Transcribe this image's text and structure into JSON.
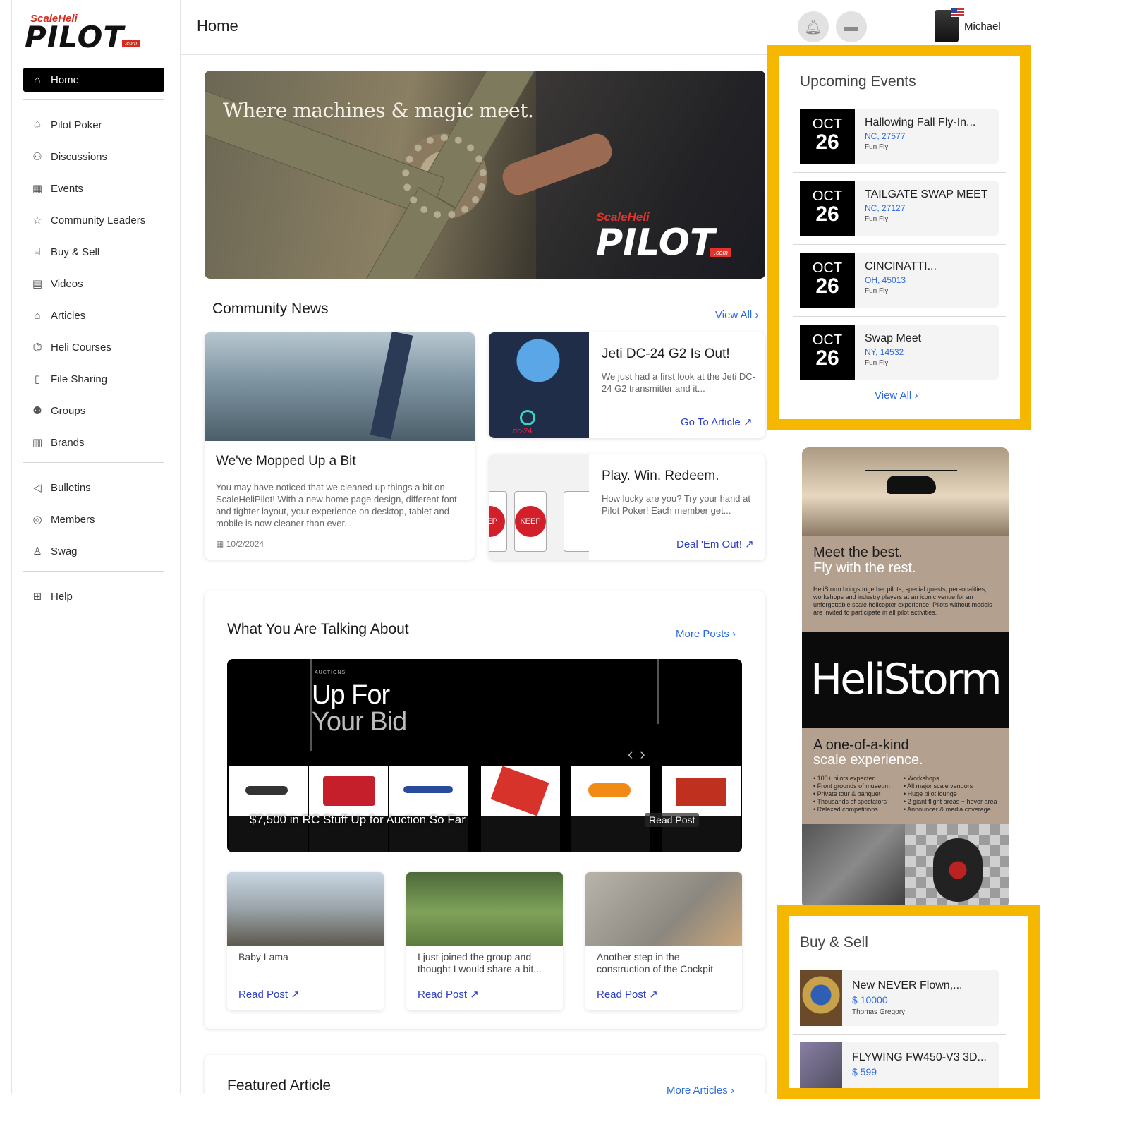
{
  "brand": {
    "logo_top": "ScaleHeli",
    "logo_main": "PILOT",
    "logo_suffix": ".com"
  },
  "header": {
    "title": "Home",
    "user_name": "Michael"
  },
  "sidebar": {
    "items": [
      {
        "label": "Home",
        "icon": "home-icon"
      },
      {
        "label": "Pilot Poker",
        "icon": "spade-icon"
      },
      {
        "label": "Discussions",
        "icon": "people-icon"
      },
      {
        "label": "Events",
        "icon": "calendar-icon"
      },
      {
        "label": "Community Leaders",
        "icon": "star-icon"
      },
      {
        "label": "Buy & Sell",
        "icon": "store-icon"
      },
      {
        "label": "Videos",
        "icon": "film-icon"
      },
      {
        "label": "Articles",
        "icon": "articles-icon"
      },
      {
        "label": "Heli Courses",
        "icon": "graduation-cap-icon"
      },
      {
        "label": "File Sharing",
        "icon": "file-icon"
      },
      {
        "label": "Groups",
        "icon": "group-icon"
      },
      {
        "label": "Brands",
        "icon": "building-icon"
      },
      {
        "label": "Bulletins",
        "icon": "megaphone-icon"
      },
      {
        "label": "Members",
        "icon": "user-circle-icon"
      },
      {
        "label": "Swag",
        "icon": "shirt-icon"
      },
      {
        "label": "Help",
        "icon": "help-icon"
      }
    ]
  },
  "hero": {
    "caption": "Where machines & magic meet.",
    "logo_top": "ScaleHeli",
    "logo_main": "PILOT",
    "logo_suffix": ".com"
  },
  "community_news": {
    "title": "Community News",
    "view_all": "View All",
    "main": {
      "title": "We've Mopped Up a Bit",
      "text": "You may have noticed that we cleaned up things a bit on ScaleHeliPilot! With a new home page design, different font and tighter layout, your experience on desktop, tablet and mobile is now cleaner than ever...",
      "date": "10/2/2024"
    },
    "side": [
      {
        "title": "Jeti DC-24 G2 Is Out!",
        "text": "We just had a first look at the Jeti DC-24 G2 transmitter and it...",
        "cta": "Go To Article"
      },
      {
        "title": "Play. Win. Redeem.",
        "text": "How lucky are you? Try your hand at Pilot Poker! Each member get...",
        "cta": "Deal 'Em Out!"
      }
    ],
    "jeti_label": "dc-24",
    "poker_keep": "KEEP",
    "poker_keep_partial": "EEP"
  },
  "talking": {
    "title": "What You Are Talking About",
    "more": "More Posts",
    "auction": {
      "kicker": "AUCTIONS",
      "line1": "Up For",
      "line2": "Your Bid",
      "caption": "$7,500 in RC Stuff Up for Auction So Far",
      "read": "Read Post"
    },
    "posts": [
      {
        "text": "Baby Lama",
        "cta": "Read Post"
      },
      {
        "text": "I just joined the group and thought I would share a bit...",
        "cta": "Read Post"
      },
      {
        "text": "Another step in the construction of the Cockpit",
        "cta": "Read Post"
      }
    ]
  },
  "featured": {
    "title": "Featured Article",
    "more": "More Articles"
  },
  "events": {
    "title": "Upcoming Events",
    "view_all": "View All",
    "items": [
      {
        "month": "OCT",
        "day": "26",
        "title": "Hallowing Fall Fly-In...",
        "location": "NC, 27577",
        "type": "Fun Fly"
      },
      {
        "month": "OCT",
        "day": "26",
        "title": "TAILGATE SWAP MEET",
        "location": "NC, 27127",
        "type": "Fun Fly"
      },
      {
        "month": "OCT",
        "day": "26",
        "title": "CINCINATTI...",
        "location": "OH, 45013",
        "type": "Fun Fly"
      },
      {
        "month": "OCT",
        "day": "26",
        "title": "Swap Meet",
        "location": "NY, 14532",
        "type": "Fun Fly"
      }
    ]
  },
  "ad": {
    "line1": "Meet the best.",
    "line2": "Fly with the rest.",
    "blurb": "HeliStorm brings together pilots, special guests, personalities, workshops and industry players at an iconic venue for an unforgettable scale helicopter experience. Pilots without models are invited to participate in all pilot activities.",
    "brand": "HeliStorm",
    "line3": "A one-of-a-kind",
    "line4": "scale experience.",
    "bullets_left": [
      "• 100+ pilots expected",
      "• Front grounds of museum",
      "• Private tour & banquet",
      "• Thousands of spectators",
      "• Relaxed competitions"
    ],
    "bullets_right": [
      "• Workshops",
      "• All major scale vendors",
      "• Huge pilot lounge",
      "• 2 giant flight areas + hover area",
      "• Announcer & media coverage"
    ]
  },
  "buy_sell": {
    "title": "Buy & Sell",
    "items": [
      {
        "title": "New NEVER Flown,...",
        "price": "$ 10000",
        "seller": "Thomas Gregory"
      },
      {
        "title": "FLYWING FW450-V3 3D...",
        "price": "$ 599",
        "seller": ""
      }
    ]
  },
  "colors": {
    "highlight": "#f5b700",
    "link_blue": "#2b6ae0",
    "cta_blue": "#2b3ec8",
    "brand_red": "#d62b1e"
  }
}
